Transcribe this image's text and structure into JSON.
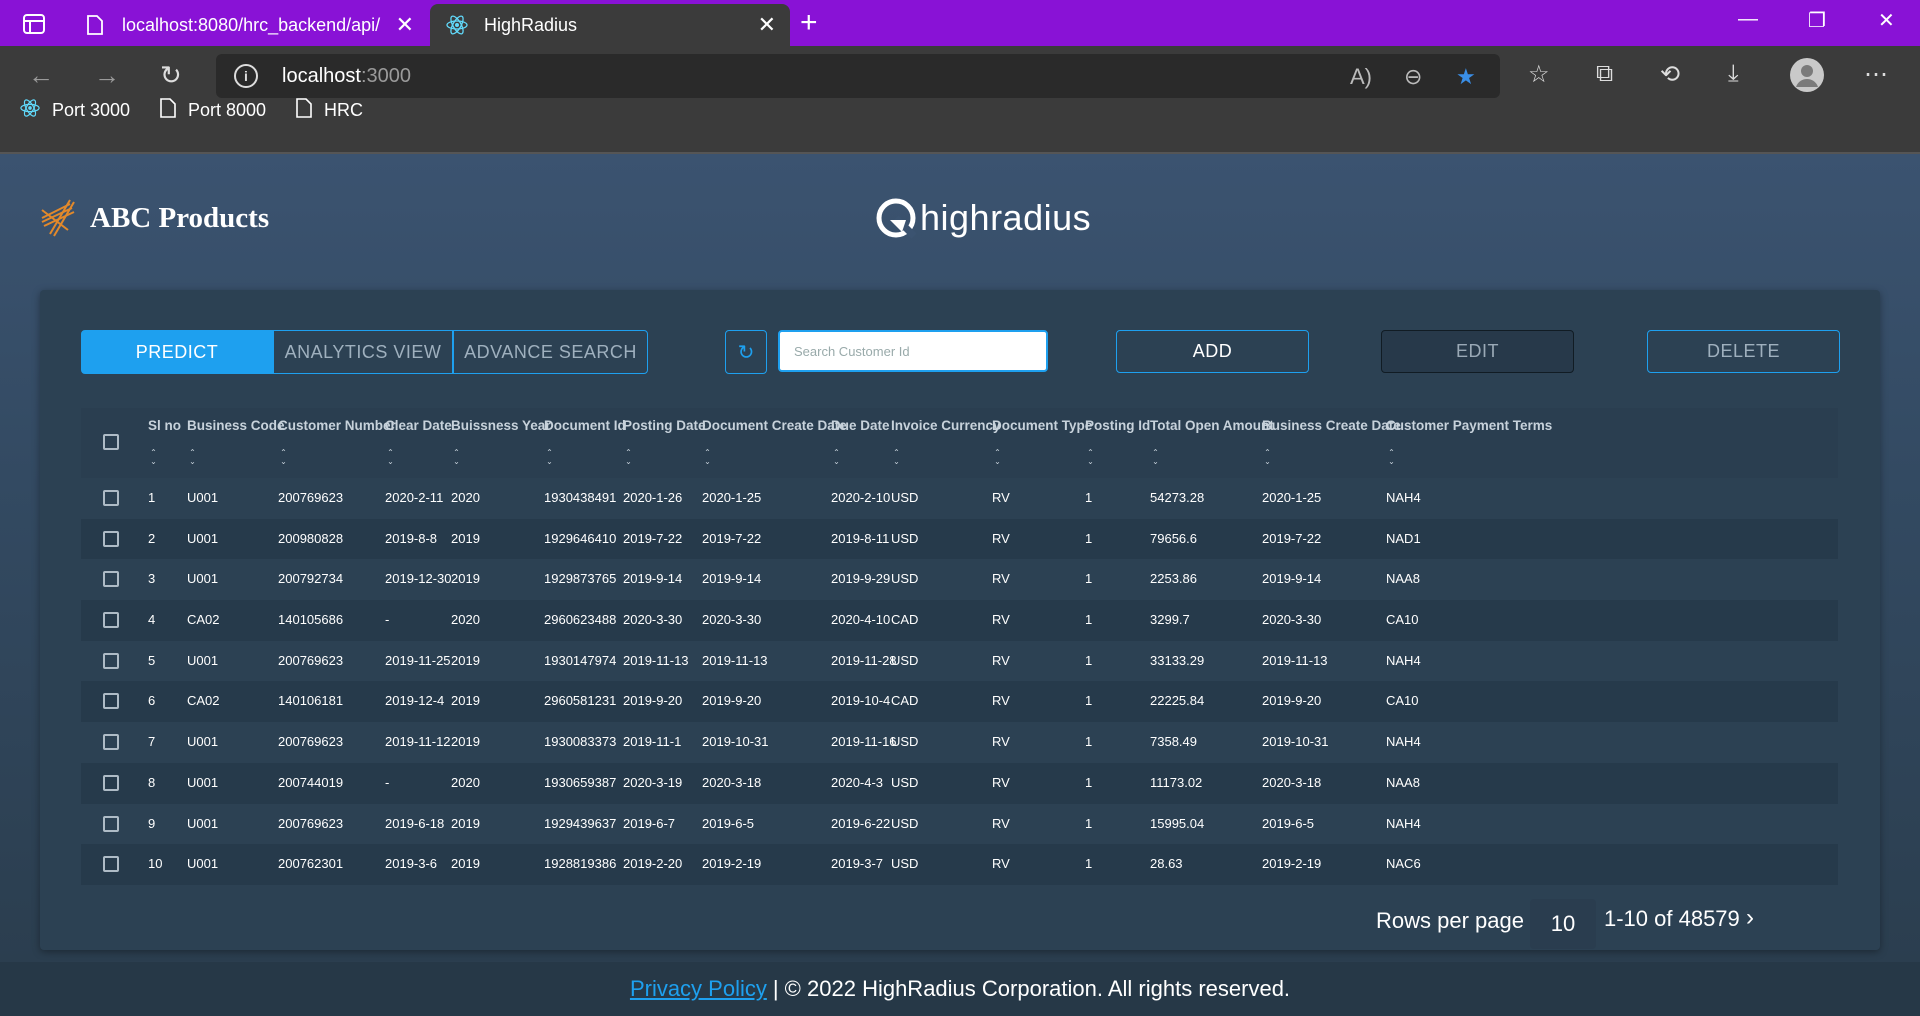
{
  "browser": {
    "tabs": [
      {
        "title": "localhost:8080/hrc_backend/api/",
        "active": false
      },
      {
        "title": "HighRadius",
        "active": true
      }
    ],
    "url_host": "localhost",
    "url_port": ":3000",
    "bookmarks": [
      "Port 3000",
      "Port 8000",
      "HRC"
    ]
  },
  "header": {
    "brand_name": "ABC Products",
    "center_logo_text": "highradius"
  },
  "controls": {
    "segments": [
      "PREDICT",
      "ANALYTICS VIEW",
      "ADVANCE SEARCH"
    ],
    "search_placeholder": "Search Customer Id",
    "add_label": "ADD",
    "edit_label": "EDIT",
    "delete_label": "DELETE"
  },
  "table": {
    "columns": [
      "Sl no",
      "Business Code",
      "Customer Number",
      "Clear Date",
      "Buissness Year",
      "Document Id",
      "Posting Date",
      "Document Create Date",
      "Due Date",
      "Invoice Currency",
      "Document Type",
      "Posting Id",
      "Total Open Amount",
      "Business Create Date",
      "Customer Payment Terms"
    ],
    "rows": [
      [
        "1",
        "U001",
        "200769623",
        "2020-2-11",
        "2020",
        "1930438491",
        "2020-1-26",
        "2020-1-25",
        "2020-2-10",
        "USD",
        "RV",
        "1",
        "54273.28",
        "2020-1-25",
        "NAH4"
      ],
      [
        "2",
        "U001",
        "200980828",
        "2019-8-8",
        "2019",
        "1929646410",
        "2019-7-22",
        "2019-7-22",
        "2019-8-11",
        "USD",
        "RV",
        "1",
        "79656.6",
        "2019-7-22",
        "NAD1"
      ],
      [
        "3",
        "U001",
        "200792734",
        "2019-12-30",
        "2019",
        "1929873765",
        "2019-9-14",
        "2019-9-14",
        "2019-9-29",
        "USD",
        "RV",
        "1",
        "2253.86",
        "2019-9-14",
        "NAA8"
      ],
      [
        "4",
        "CA02",
        "140105686",
        "-",
        "2020",
        "2960623488",
        "2020-3-30",
        "2020-3-30",
        "2020-4-10",
        "CAD",
        "RV",
        "1",
        "3299.7",
        "2020-3-30",
        "CA10"
      ],
      [
        "5",
        "U001",
        "200769623",
        "2019-11-25",
        "2019",
        "1930147974",
        "2019-11-13",
        "2019-11-13",
        "2019-11-28",
        "USD",
        "RV",
        "1",
        "33133.29",
        "2019-11-13",
        "NAH4"
      ],
      [
        "6",
        "CA02",
        "140106181",
        "2019-12-4",
        "2019",
        "2960581231",
        "2019-9-20",
        "2019-9-20",
        "2019-10-4",
        "CAD",
        "RV",
        "1",
        "22225.84",
        "2019-9-20",
        "CA10"
      ],
      [
        "7",
        "U001",
        "200769623",
        "2019-11-12",
        "2019",
        "1930083373",
        "2019-11-1",
        "2019-10-31",
        "2019-11-16",
        "USD",
        "RV",
        "1",
        "7358.49",
        "2019-10-31",
        "NAH4"
      ],
      [
        "8",
        "U001",
        "200744019",
        "-",
        "2020",
        "1930659387",
        "2020-3-19",
        "2020-3-18",
        "2020-4-3",
        "USD",
        "RV",
        "1",
        "11173.02",
        "2020-3-18",
        "NAA8"
      ],
      [
        "9",
        "U001",
        "200769623",
        "2019-6-18",
        "2019",
        "1929439637",
        "2019-6-7",
        "2019-6-5",
        "2019-6-22",
        "USD",
        "RV",
        "1",
        "15995.04",
        "2019-6-5",
        "NAH4"
      ],
      [
        "10",
        "U001",
        "200762301",
        "2019-3-6",
        "2019",
        "1928819386",
        "2019-2-20",
        "2019-2-19",
        "2019-3-7",
        "USD",
        "RV",
        "1",
        "28.63",
        "2019-2-19",
        "NAC6"
      ]
    ]
  },
  "pagination": {
    "rows_per_page_label": "Rows per page",
    "rows_per_page": "10",
    "range": "1-10 of 48579"
  },
  "footer": {
    "privacy_link": "Privacy Policy",
    "copyright": "| © 2022 HighRadius Corporation. All rights reserved."
  }
}
